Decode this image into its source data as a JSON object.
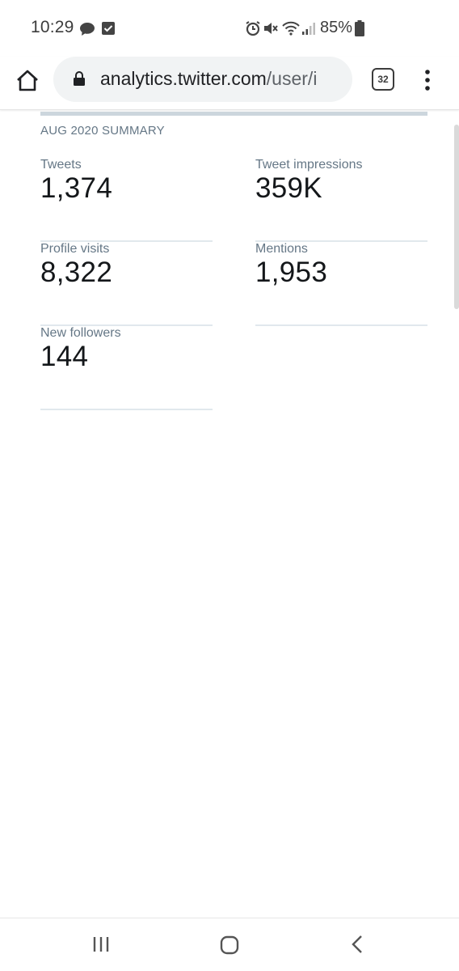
{
  "status_bar": {
    "time": "10:29",
    "battery": "85%",
    "icons": [
      "chat-bubble-icon",
      "check-box-icon",
      "alarm-icon",
      "mute-icon",
      "wifi-icon",
      "signal-icon",
      "battery-icon"
    ]
  },
  "browser": {
    "url_domain": "analytics.twitter.com",
    "url_path": "/user/i",
    "tab_count": "32"
  },
  "summary": {
    "heading": "AUG 2020 SUMMARY",
    "stats": [
      {
        "label": "Tweets",
        "value": "1,374"
      },
      {
        "label": "Tweet impressions",
        "value": "359K"
      },
      {
        "label": "Profile visits",
        "value": "8,322"
      },
      {
        "label": "Mentions",
        "value": "1,953"
      },
      {
        "label": "New followers",
        "value": "144"
      }
    ]
  },
  "nav_bar": {
    "buttons": [
      "recents-button",
      "home-button",
      "back-button"
    ]
  },
  "colors": {
    "label_gray": "#657786",
    "value_dark": "#14171a",
    "divider": "#e1e8ed"
  }
}
